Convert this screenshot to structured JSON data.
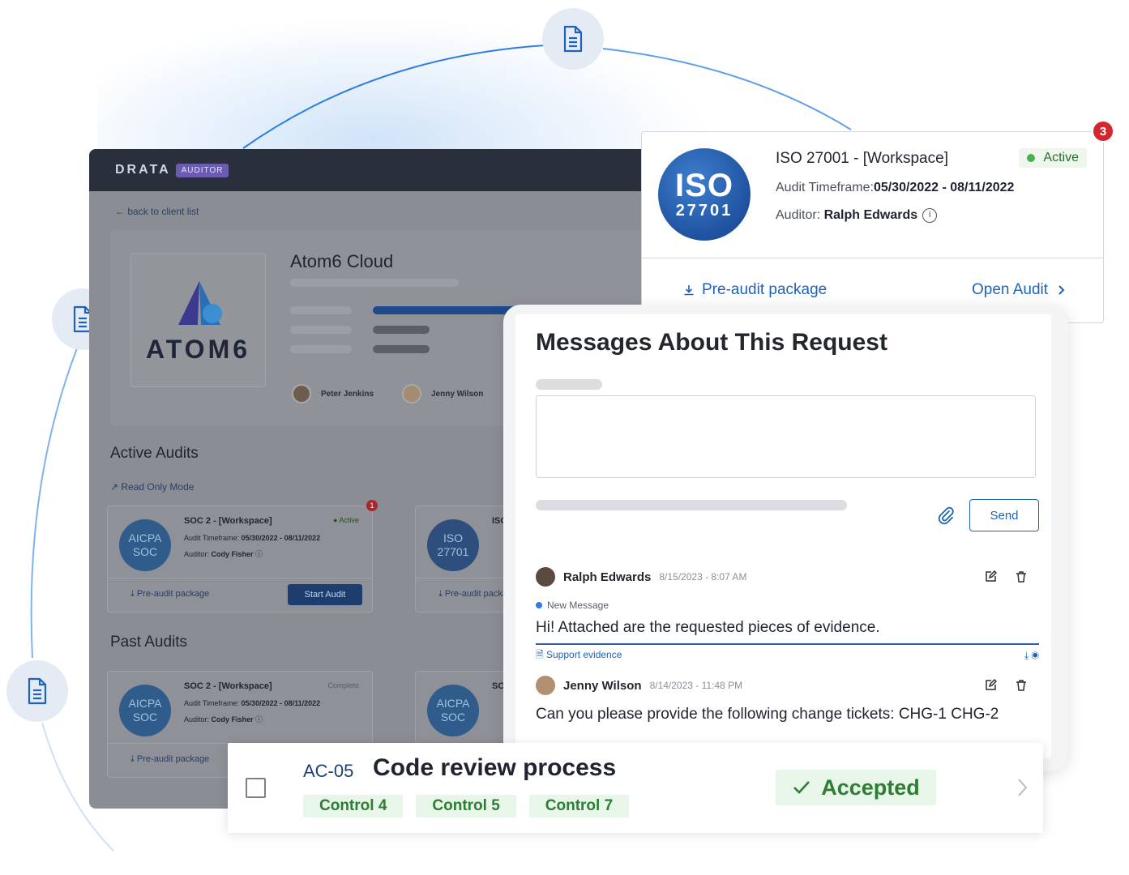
{
  "app": {
    "logo": "DRATA",
    "role_badge": "AUDITOR",
    "back_link": "back to client list",
    "client_name": "Atom6 Cloud",
    "client_logo_text": "ATOM6",
    "people": [
      "Peter Jenkins",
      "Jenny Wilson"
    ],
    "active_audits_title": "Active Audits",
    "read_only": "Read Only Mode",
    "past_audits_title": "Past Audits",
    "active_cards": [
      {
        "badge": "AICPA SOC",
        "title": "SOC 2 - [Workspace]",
        "status": "Active",
        "timeframe_label": "Audit Timeframe:",
        "timeframe": "05/30/2022 - 08/11/2022",
        "auditor_label": "Auditor:",
        "auditor": "Cody Fisher",
        "package": "Pre-audit package",
        "action": "Start Audit",
        "notif": "1"
      },
      {
        "badge": "ISO 27701",
        "title": "ISO",
        "package": "Pre-audit package"
      }
    ],
    "past_cards": [
      {
        "badge": "AICPA SOC",
        "title": "SOC 2 - [Workspace]",
        "status": "Complete",
        "timeframe_label": "Audit Timeframe:",
        "timeframe": "05/30/2022 - 08/11/2022",
        "auditor_label": "Auditor:",
        "auditor": "Cody Fisher",
        "package": "Pre-audit package"
      },
      {
        "badge": "AICPA SOC",
        "title": "SO"
      }
    ]
  },
  "iso_card": {
    "badge_big": "ISO",
    "badge_small": "27701",
    "title": "ISO 27001 - [Workspace]",
    "status": "Active",
    "timeframe_label": "Audit Timeframe:",
    "timeframe": "05/30/2022 - 08/11/2022",
    "auditor_label": "Auditor:",
    "auditor": "Ralph Edwards",
    "package_link": "Pre-audit package",
    "open_link": "Open Audit",
    "notif_count": "3"
  },
  "messages": {
    "title": "Messages About This Request",
    "send": "Send",
    "new_message_label": "New Message",
    "items": [
      {
        "author": "Ralph Edwards",
        "time": "8/15/2023 - 8:07 AM",
        "text": "Hi! Attached are the requested pieces of evidence.",
        "attachment": "Support evidence"
      },
      {
        "author": "Jenny Wilson",
        "time": "8/14/2023 - 11:48 PM",
        "text": "Can you please provide the following change tickets: CHG-1 CHG-2"
      }
    ]
  },
  "control": {
    "id": "AC-05",
    "title": "Code review process",
    "tags": [
      "Control 4",
      "Control 5",
      "Control 7"
    ],
    "status": "Accepted"
  },
  "colors": {
    "brand_blue": "#1f63b8",
    "success_green": "#2d7d32",
    "notif_red": "#d3272f",
    "app_dark": "#2a2f3c"
  }
}
